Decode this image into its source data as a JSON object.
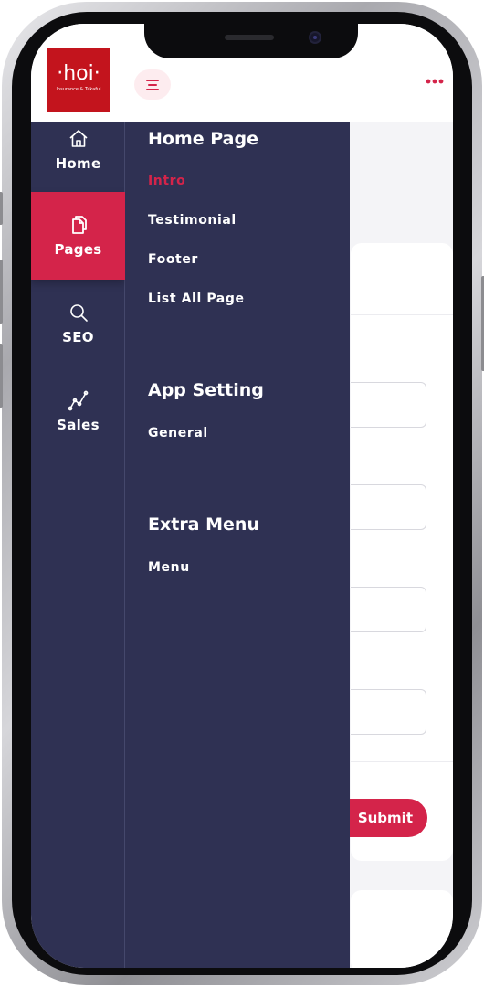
{
  "brand": {
    "logo_text": "·hoi·",
    "logo_subtext": "Insurance & Takaful",
    "accent_color": "#d4244a",
    "sidebar_color": "#2f3153"
  },
  "header": {
    "menu_toggle_icon": "hamburger-icon",
    "more_icon": "more-dots-icon"
  },
  "rail": {
    "items": [
      {
        "label": "Home",
        "icon": "home-icon",
        "active": false
      },
      {
        "label": "Pages",
        "icon": "pages-icon",
        "active": true
      },
      {
        "label": "SEO",
        "icon": "search-icon",
        "active": false
      },
      {
        "label": "Sales",
        "icon": "sales-chart-icon",
        "active": false
      }
    ]
  },
  "submenu": {
    "sections": [
      {
        "title": "Home Page",
        "items": [
          "Intro",
          "Testimonial",
          "Footer",
          "List All Page"
        ],
        "active_item": "Intro"
      },
      {
        "title": "App Setting",
        "items": [
          "General"
        ]
      },
      {
        "title": "Extra Menu",
        "items": [
          "Menu"
        ]
      }
    ]
  },
  "form": {
    "submit_label": "Submit"
  }
}
